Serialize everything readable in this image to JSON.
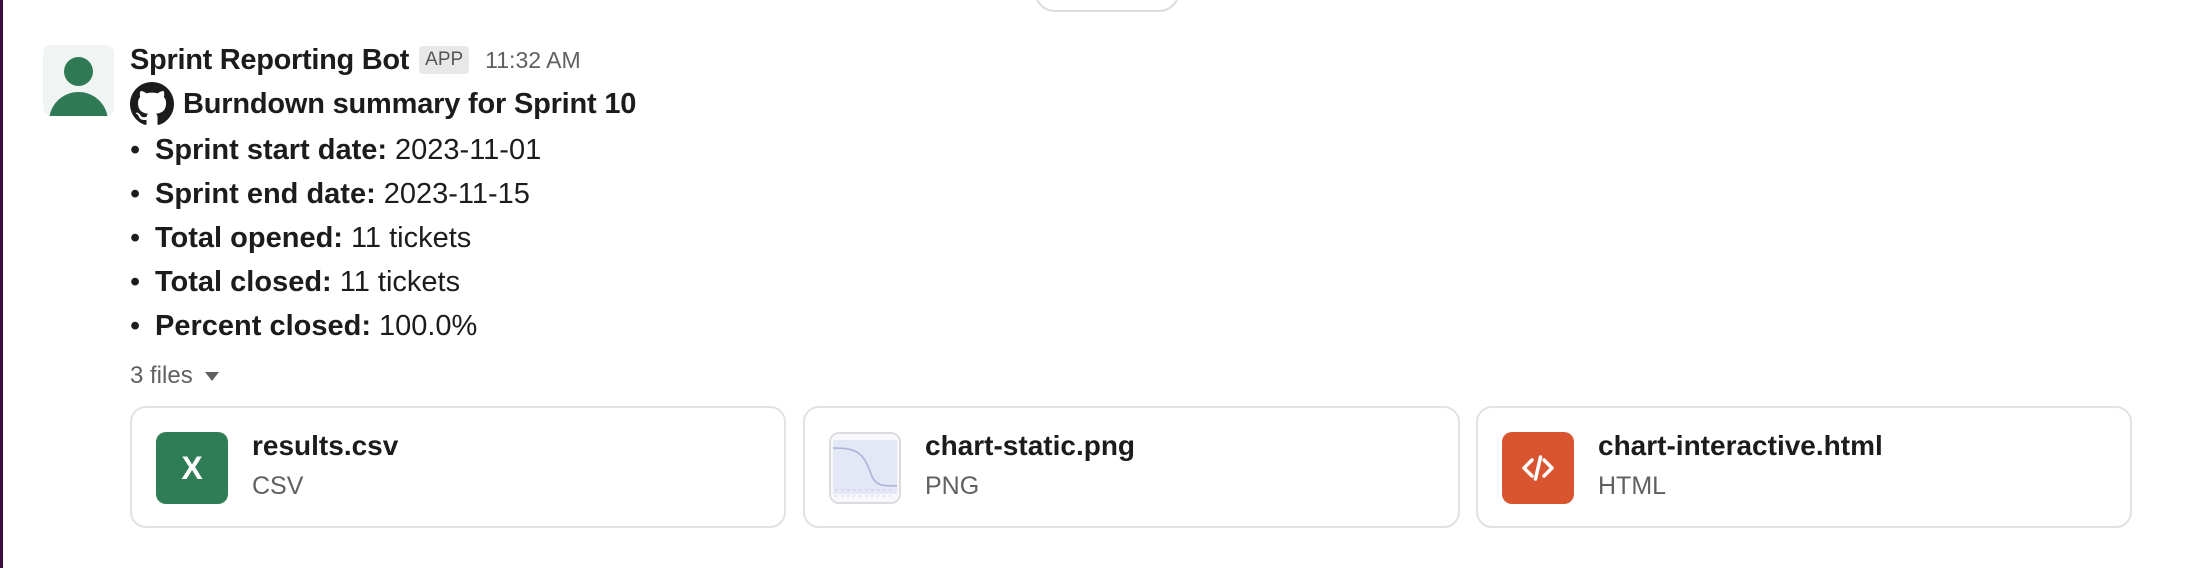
{
  "message": {
    "sender": "Sprint Reporting Bot",
    "badge": "APP",
    "timestamp": "11:32 AM",
    "summary_title": "Burndown summary for Sprint 10",
    "bullets": [
      {
        "label": "Sprint start date:",
        "value": "2023-11-01"
      },
      {
        "label": "Sprint end date:",
        "value": "2023-11-15"
      },
      {
        "label": "Total opened:",
        "value": "11 tickets"
      },
      {
        "label": "Total closed:",
        "value": "11 tickets"
      },
      {
        "label": "Percent closed:",
        "value": "100.0%"
      }
    ],
    "bullet_char": "•"
  },
  "files": {
    "toggle_label": "3 files",
    "items": [
      {
        "name": "results.csv",
        "type": "CSV",
        "icon": "excel-icon",
        "icon_text": "X",
        "color": "#2e7d57"
      },
      {
        "name": "chart-static.png",
        "type": "PNG",
        "icon": "image-thumbnail",
        "color": "#e6e9f7"
      },
      {
        "name": "chart-interactive.html",
        "type": "HTML",
        "icon": "code-icon",
        "color": "#d9552f"
      }
    ]
  },
  "colors": {
    "sidebar_edge": "#3f0e40",
    "avatar": "#2f7a55",
    "muted_text": "#616061"
  }
}
